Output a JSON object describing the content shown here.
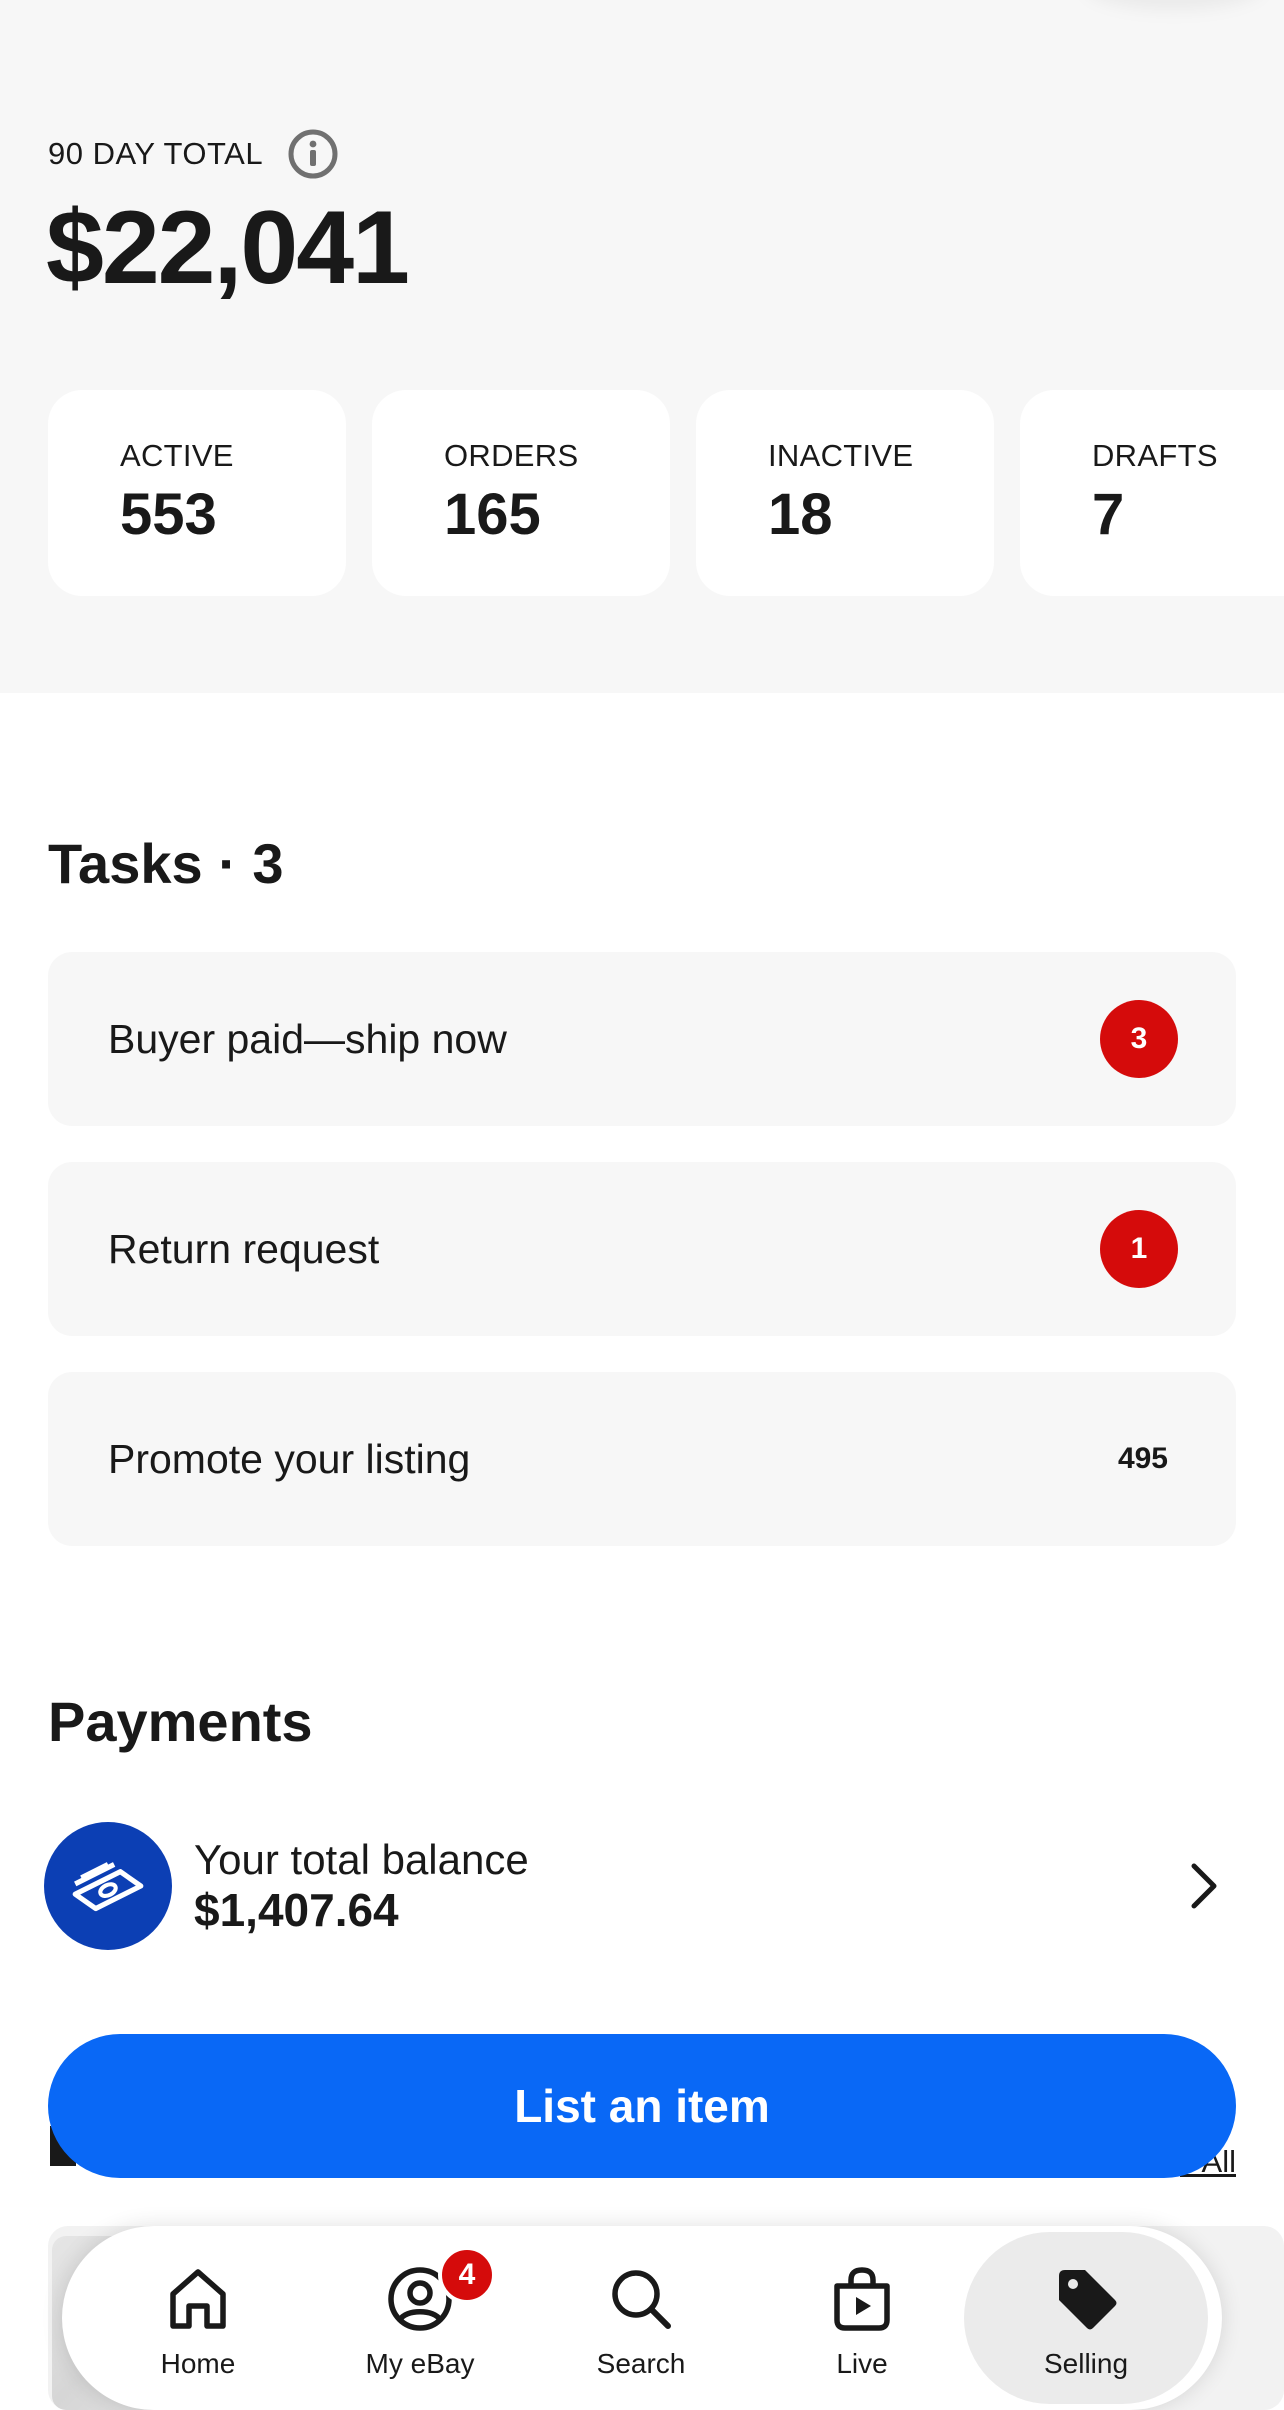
{
  "summary": {
    "total_label": "90 DAY TOTAL",
    "total_amount": "$22,041",
    "stats": [
      {
        "label": "ACTIVE",
        "value": "553"
      },
      {
        "label": "ORDERS",
        "value": "165"
      },
      {
        "label": "INACTIVE",
        "value": "18"
      },
      {
        "label": "DRAFTS",
        "value": "7"
      }
    ]
  },
  "tasks": {
    "title": "Tasks · 3",
    "items": [
      {
        "label": "Buyer paid—ship now",
        "count": "3",
        "style": "badge"
      },
      {
        "label": "Return request",
        "count": "1",
        "style": "badge"
      },
      {
        "label": "Promote your listing",
        "count": "495",
        "style": "plain"
      }
    ]
  },
  "payments": {
    "title": "Payments",
    "balance_label": "Your total balance",
    "balance_value": "$1,407.64"
  },
  "partial_section": {
    "see_all_label": "See All"
  },
  "cta": {
    "label": "List an item"
  },
  "nav": {
    "items": [
      {
        "label": "Home",
        "icon": "home-icon"
      },
      {
        "label": "My eBay",
        "icon": "account-icon",
        "badge": "4"
      },
      {
        "label": "Search",
        "icon": "search-icon"
      },
      {
        "label": "Live",
        "icon": "live-bag-icon"
      },
      {
        "label": "Selling",
        "icon": "tag-icon",
        "active": true
      }
    ]
  },
  "colors": {
    "accent": "#0968f6",
    "badge": "#d50b0b",
    "payments_icon_bg": "#0c3fb4",
    "summary_bg": "#f7f7f7"
  }
}
